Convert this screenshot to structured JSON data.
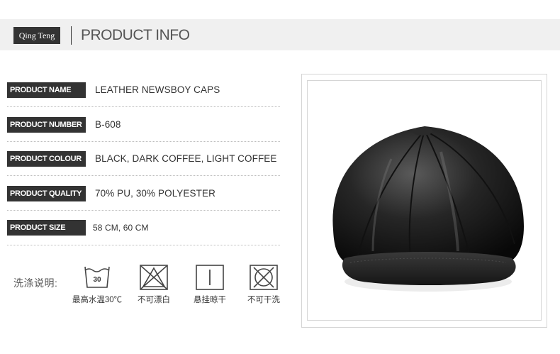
{
  "header": {
    "brand": "Qing Teng",
    "title": "PRODUCT INFO"
  },
  "specs": [
    {
      "label": "PRODUCT NAME",
      "value": "LEATHER NEWSBOY CAPS"
    },
    {
      "label": "PRODUCT NUMBER",
      "value": "B-608"
    },
    {
      "label": "PRODUCT COLOUR",
      "value": "BLACK, DARK COFFEE, LIGHT COFFEE"
    },
    {
      "label": "PRODUCT QUALITY",
      "value": "70% PU, 30% POLYESTER"
    },
    {
      "label": "PRODUCT SIZE",
      "value": "58 CM, 60 CM"
    }
  ],
  "care": {
    "title": "洗涤说明:",
    "items": [
      {
        "icon": "wash-30-icon",
        "temp": "30",
        "caption": "最高水温30℃"
      },
      {
        "icon": "no-bleach-icon",
        "caption": "不可漂白"
      },
      {
        "icon": "hang-dry-icon",
        "caption": "悬挂晾干"
      },
      {
        "icon": "no-dry-clean-icon",
        "caption": "不可干洗"
      }
    ]
  },
  "product_image": {
    "subject": "black leather newsboy cap",
    "color": "#1a1a1a"
  }
}
